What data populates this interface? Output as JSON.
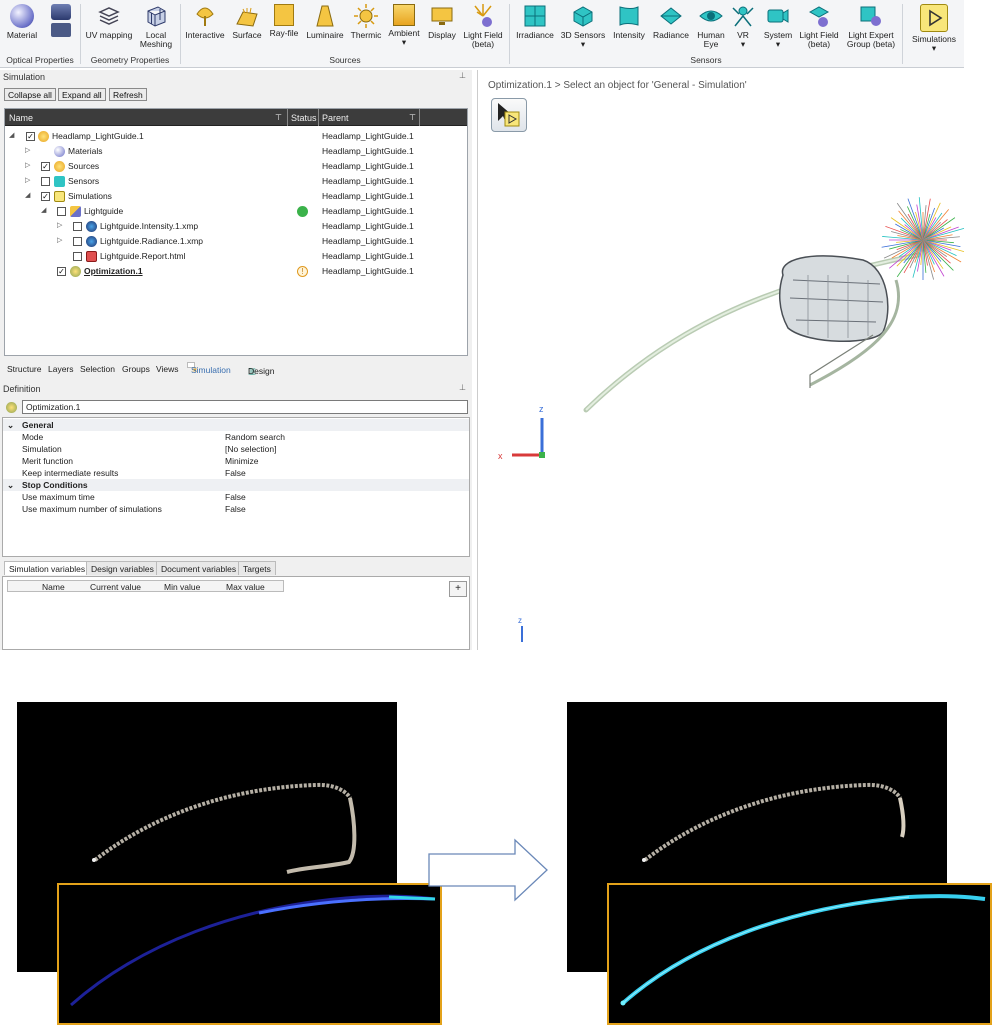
{
  "ribbon": {
    "optical": [
      {
        "label": "Material",
        "icon": "material-sphere-icon"
      },
      {
        "label": "",
        "icon": "optical-properties-icon"
      }
    ],
    "optical_group": "Optical Properties",
    "geometry": [
      {
        "label": "UV mapping",
        "icon": "uv-mapping-icon"
      },
      {
        "label": "Local Meshing",
        "icon": "local-meshing-icon"
      }
    ],
    "geometry_group": "Geometry Properties",
    "sources": [
      {
        "label": "Interactive",
        "icon": "interactive-source-icon"
      },
      {
        "label": "Surface",
        "icon": "surface-source-icon"
      },
      {
        "label": "Ray-file",
        "icon": "ray-file-icon"
      },
      {
        "label": "Luminaire",
        "icon": "luminaire-icon"
      },
      {
        "label": "Thermic",
        "icon": "thermic-icon"
      },
      {
        "label": "Ambient",
        "icon": "ambient-icon"
      },
      {
        "label": "Display",
        "icon": "display-icon"
      },
      {
        "label": "Light Field (beta)",
        "icon": "light-field-icon"
      }
    ],
    "sources_group": "Sources",
    "sensors": [
      {
        "label": "Irradiance",
        "icon": "irradiance-icon"
      },
      {
        "label": "3D Sensors",
        "icon": "3d-sensors-icon"
      },
      {
        "label": "Intensity",
        "icon": "intensity-icon"
      },
      {
        "label": "Radiance",
        "icon": "radiance-icon"
      },
      {
        "label": "Human Eye",
        "icon": "human-eye-icon"
      },
      {
        "label": "VR",
        "icon": "vr-icon"
      },
      {
        "label": "System",
        "icon": "system-icon"
      },
      {
        "label": "Light Field (beta)",
        "icon": "light-field-sensor-icon"
      },
      {
        "label": "Light Expert Group (beta)",
        "icon": "light-expert-icon"
      }
    ],
    "sensors_group": "Sensors",
    "simulations_label": "Simulations"
  },
  "simulation_panel": {
    "title": "Simulation",
    "collapse": "Collapse all",
    "expand": "Expand all",
    "refresh": "Refresh",
    "columns": {
      "name": "Name",
      "status": "Status",
      "parent": "Parent"
    },
    "rows": [
      {
        "name": "Headlamp_LightGuide.1",
        "parent": "Headlamp_LightGuide.1",
        "status": ""
      },
      {
        "name": "Materials",
        "parent": "Headlamp_LightGuide.1",
        "status": ""
      },
      {
        "name": "Sources",
        "parent": "Headlamp_LightGuide.1",
        "status": ""
      },
      {
        "name": "Sensors",
        "parent": "Headlamp_LightGuide.1",
        "status": ""
      },
      {
        "name": "Simulations",
        "parent": "Headlamp_LightGuide.1",
        "status": ""
      },
      {
        "name": "Lightguide",
        "parent": "Headlamp_LightGuide.1",
        "status": "run"
      },
      {
        "name": "Lightguide.Intensity.1.xmp",
        "parent": "Headlamp_LightGuide.1",
        "status": ""
      },
      {
        "name": "Lightguide.Radiance.1.xmp",
        "parent": "Headlamp_LightGuide.1",
        "status": ""
      },
      {
        "name": "Lightguide.Report.html",
        "parent": "Headlamp_LightGuide.1",
        "status": ""
      },
      {
        "name": "Optimization.1",
        "parent": "Headlamp_LightGuide.1",
        "status": "warning"
      }
    ],
    "tabs": [
      "Structure",
      "Layers",
      "Selection",
      "Groups",
      "Views",
      "Simulation",
      "Design"
    ]
  },
  "definition": {
    "title": "Definition",
    "name": "Optimization.1",
    "general": "General",
    "props": [
      {
        "k": "Mode",
        "v": "Random search"
      },
      {
        "k": "Simulation",
        "v": "[No selection]"
      },
      {
        "k": "Merit function",
        "v": "Minimize"
      },
      {
        "k": "Keep intermediate results",
        "v": "False"
      }
    ],
    "stop": "Stop Conditions",
    "stop_props": [
      {
        "k": "Use maximum time",
        "v": "False"
      },
      {
        "k": "Use maximum number of simulations",
        "v": "False"
      }
    ]
  },
  "variables": {
    "tabs": [
      "Simulation variables",
      "Design variables",
      "Document variables",
      "Targets"
    ],
    "columns": [
      "Name",
      "Current value",
      "Min value",
      "Max value"
    ],
    "add": "+"
  },
  "viewport": {
    "breadcrumb": "Optimization.1 > Select an object for 'General - Simulation'",
    "axis_z": "z",
    "axis_x": "x"
  }
}
